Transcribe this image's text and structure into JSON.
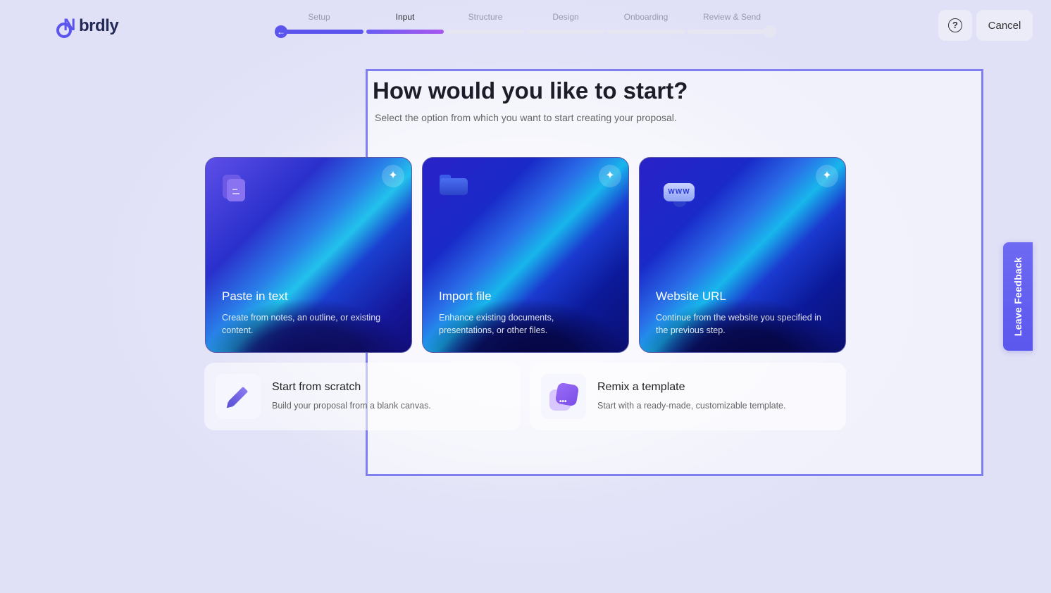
{
  "brand": {
    "logo_text": "brdly"
  },
  "stepper": {
    "steps": [
      {
        "label": "Setup",
        "state": "done"
      },
      {
        "label": "Input",
        "state": "current"
      },
      {
        "label": "Structure",
        "state": "upcoming"
      },
      {
        "label": "Design",
        "state": "upcoming"
      },
      {
        "label": "Onboarding",
        "state": "upcoming"
      },
      {
        "label": "Review & Send",
        "state": "upcoming"
      }
    ],
    "back_icon": "←"
  },
  "header": {
    "help_icon": "?",
    "cancel_label": "Cancel"
  },
  "main": {
    "title": "How would you like to start?",
    "subtitle": "Select the option from which you want to start creating your proposal.",
    "cards": [
      {
        "title": "Paste in text",
        "desc": "Create from notes, an outline, or existing content.",
        "icon": "document-icon",
        "spark": "✦"
      },
      {
        "title": "Import file",
        "desc": "Enhance existing documents, presentations, or other files.",
        "icon": "folder-icon",
        "spark": "✦"
      },
      {
        "title": "Website URL",
        "desc": "Continue from the website you specified in the previous step.",
        "icon": "www-icon",
        "icon_text": "WWW",
        "spark": "✦"
      }
    ],
    "options": [
      {
        "title": "Start from scratch",
        "desc": "Build your proposal from a blank canvas.",
        "icon": "pencil-icon"
      },
      {
        "title": "Remix a template",
        "desc": "Start with a ready-made, customizable template.",
        "icon": "remix-icon",
        "icon_text": "•••"
      }
    ]
  },
  "feedback": {
    "label": "Leave Feedback"
  },
  "colors": {
    "accent": "#5b55ee",
    "selection_border": "#7f7ff0"
  }
}
